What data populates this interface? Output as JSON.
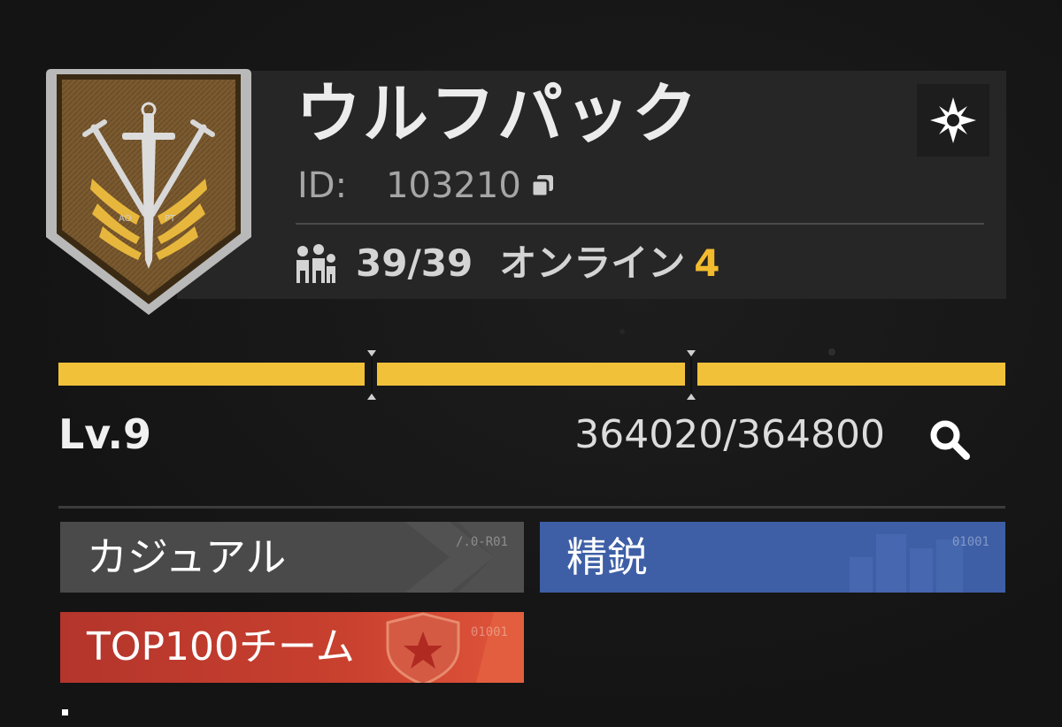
{
  "team": {
    "name": "ウルフパック",
    "id_label": "ID:",
    "id_value": "103210",
    "members": "39/39",
    "online_label": "オンライン",
    "online_count": "4",
    "emblem_text_left": "AO",
    "emblem_text_right": "PT"
  },
  "level": {
    "label": "Lv.9",
    "xp": "364020/364800",
    "progress_fraction": 0.998
  },
  "tags": {
    "casual": "カジュアル",
    "casual_code": "/.0-R01",
    "elite": "精鋭",
    "elite_code": "01001",
    "top": "TOP100チーム",
    "top_code": "01001"
  },
  "colors": {
    "accent_yellow": "#f2c13a",
    "elite_blue": "#3e5fa6",
    "top_red": "#c8402e",
    "casual_gray": "#4a4a4a"
  },
  "icons": [
    "emblem-shield-icon",
    "copy-icon",
    "members-icon",
    "settings-icon",
    "search-icon",
    "star-shield-icon"
  ]
}
